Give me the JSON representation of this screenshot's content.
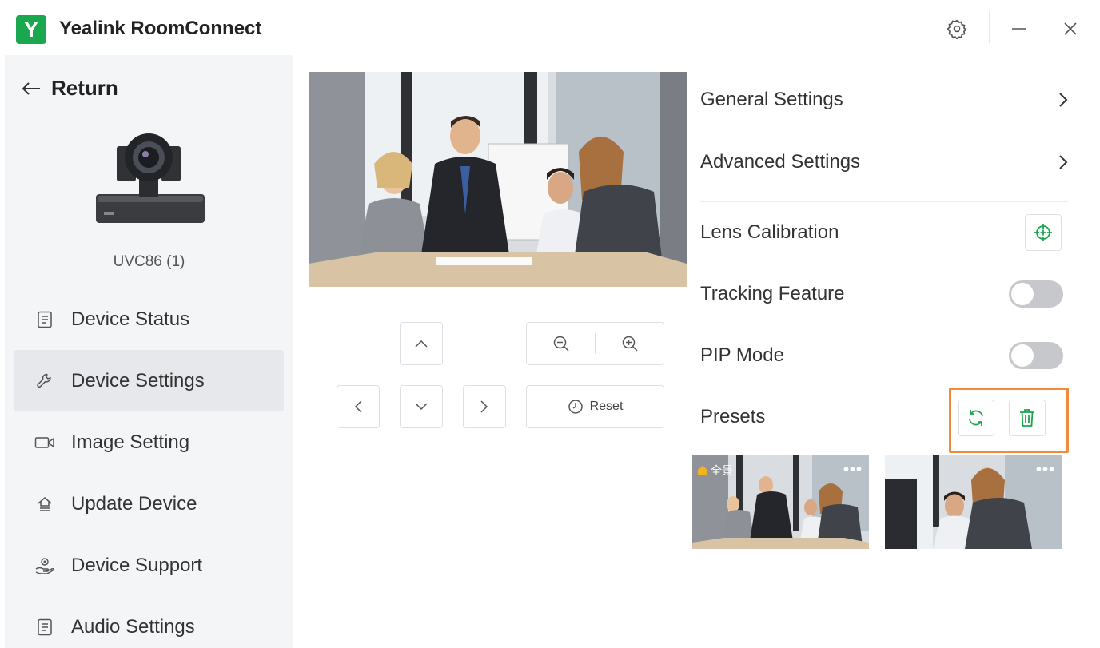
{
  "app": {
    "logo_letter": "Y",
    "title": "Yealink RoomConnect"
  },
  "sidebar": {
    "return_label": "Return",
    "device_name": "UVC86 (1)",
    "items": [
      {
        "label": "Device Status",
        "icon": "document-icon"
      },
      {
        "label": "Device Settings",
        "icon": "wrench-icon",
        "active": true
      },
      {
        "label": "Image Setting",
        "icon": "video-camera-icon"
      },
      {
        "label": "Update Device",
        "icon": "upload-icon"
      },
      {
        "label": "Device Support",
        "icon": "support-icon"
      },
      {
        "label": "Audio Settings",
        "icon": "document-icon"
      }
    ]
  },
  "camera_controls": {
    "reset_label": "Reset"
  },
  "settings": {
    "general": "General Settings",
    "advanced": "Advanced Settings",
    "lens_calibration": "Lens Calibration",
    "tracking_feature": "Tracking Feature",
    "tracking_enabled": false,
    "pip_mode": "PIP Mode",
    "pip_enabled": false,
    "presets": "Presets"
  },
  "presets": [
    {
      "label": "全景",
      "more": "•••"
    },
    {
      "label": "",
      "more": "•••"
    }
  ],
  "colors": {
    "accent": "#1aa84f",
    "highlight": "#f08a3c",
    "toggle_off": "#c6c8cc"
  }
}
